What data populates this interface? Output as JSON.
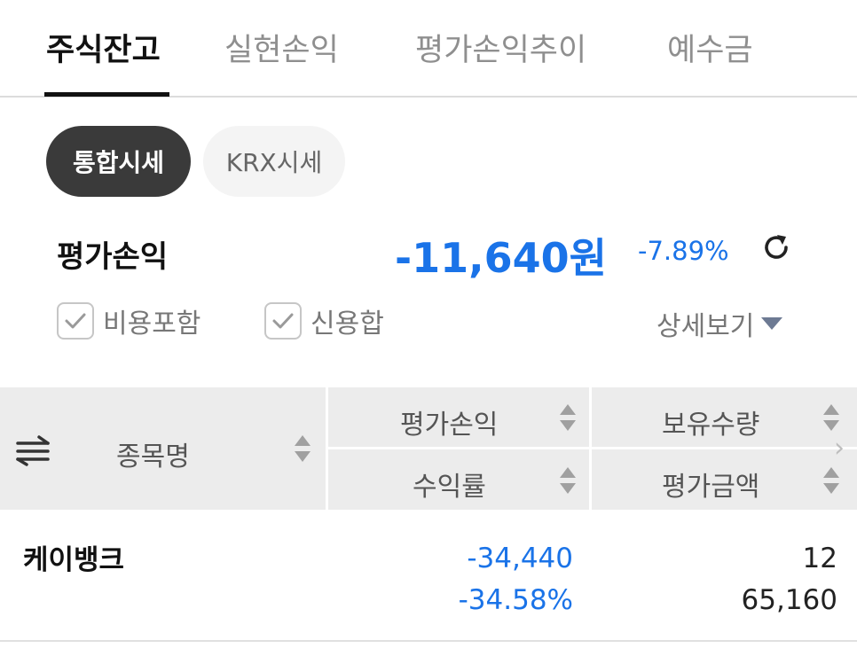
{
  "tabs": [
    {
      "label": "주식잔고",
      "active": true
    },
    {
      "label": "실현손익",
      "active": false
    },
    {
      "label": "평가손익추이",
      "active": false
    },
    {
      "label": "예수금",
      "active": false
    }
  ],
  "price_source": {
    "integrated": "통합시세",
    "krx": "KRX시세",
    "selected": "통합시세"
  },
  "summary": {
    "label": "평가손익",
    "amount": "-11,640원",
    "rate": "-7.89%",
    "refresh_icon": "refresh-icon"
  },
  "options": {
    "include_costs": {
      "label": "비용포함",
      "checked": true
    },
    "include_credit": {
      "label": "신용합",
      "checked": true
    },
    "detail_view": "상세보기"
  },
  "table": {
    "headers": {
      "name": "종목명",
      "pnl": "평가손익",
      "quantity": "보유수량",
      "return_rate": "수익률",
      "eval_amount": "평가금액"
    },
    "rows": [
      {
        "name": "케이뱅크",
        "pnl": "-34,440",
        "quantity": "12",
        "return_rate": "-34.58%",
        "eval_amount": "65,160"
      }
    ]
  },
  "colors": {
    "accent_blue": "#1a73e8",
    "pill_active": "#3a3a3a",
    "header_bg": "#ececec"
  }
}
